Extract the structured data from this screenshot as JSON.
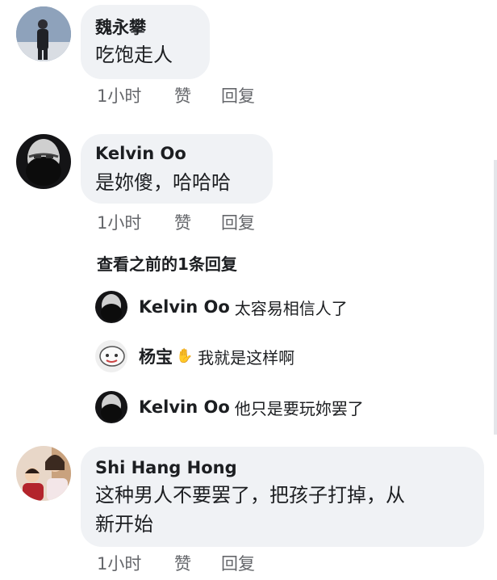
{
  "comments": [
    {
      "author": "魏永攀",
      "text": "吃饱走人",
      "time": "1小时",
      "like": "赞",
      "reply": "回复"
    },
    {
      "author": "Kelvin Oo",
      "text": "是妳傻，哈哈哈",
      "time": "1小时",
      "like": "赞",
      "reply": "回复",
      "view_previous": "查看之前的1条回复",
      "replies": [
        {
          "author": "Kelvin Oo",
          "text": "太容易相信人了"
        },
        {
          "author": "杨宝",
          "badge_icon": "waving-hand-icon",
          "badge_glyph": "✋",
          "text": "我就是这样啊"
        },
        {
          "author": "Kelvin Oo",
          "text": "他只是要玩妳罢了"
        }
      ]
    },
    {
      "author": "Shi Hang Hong",
      "text_line1": "这种男人不要罢了，把孩子打掉，从",
      "text_line2": "新开始",
      "time": "1小时",
      "like": "赞",
      "reply": "回复"
    }
  ],
  "colors": {
    "bubble": "#f0f2f5",
    "text": "#1c1e21",
    "meta": "#65676b"
  }
}
